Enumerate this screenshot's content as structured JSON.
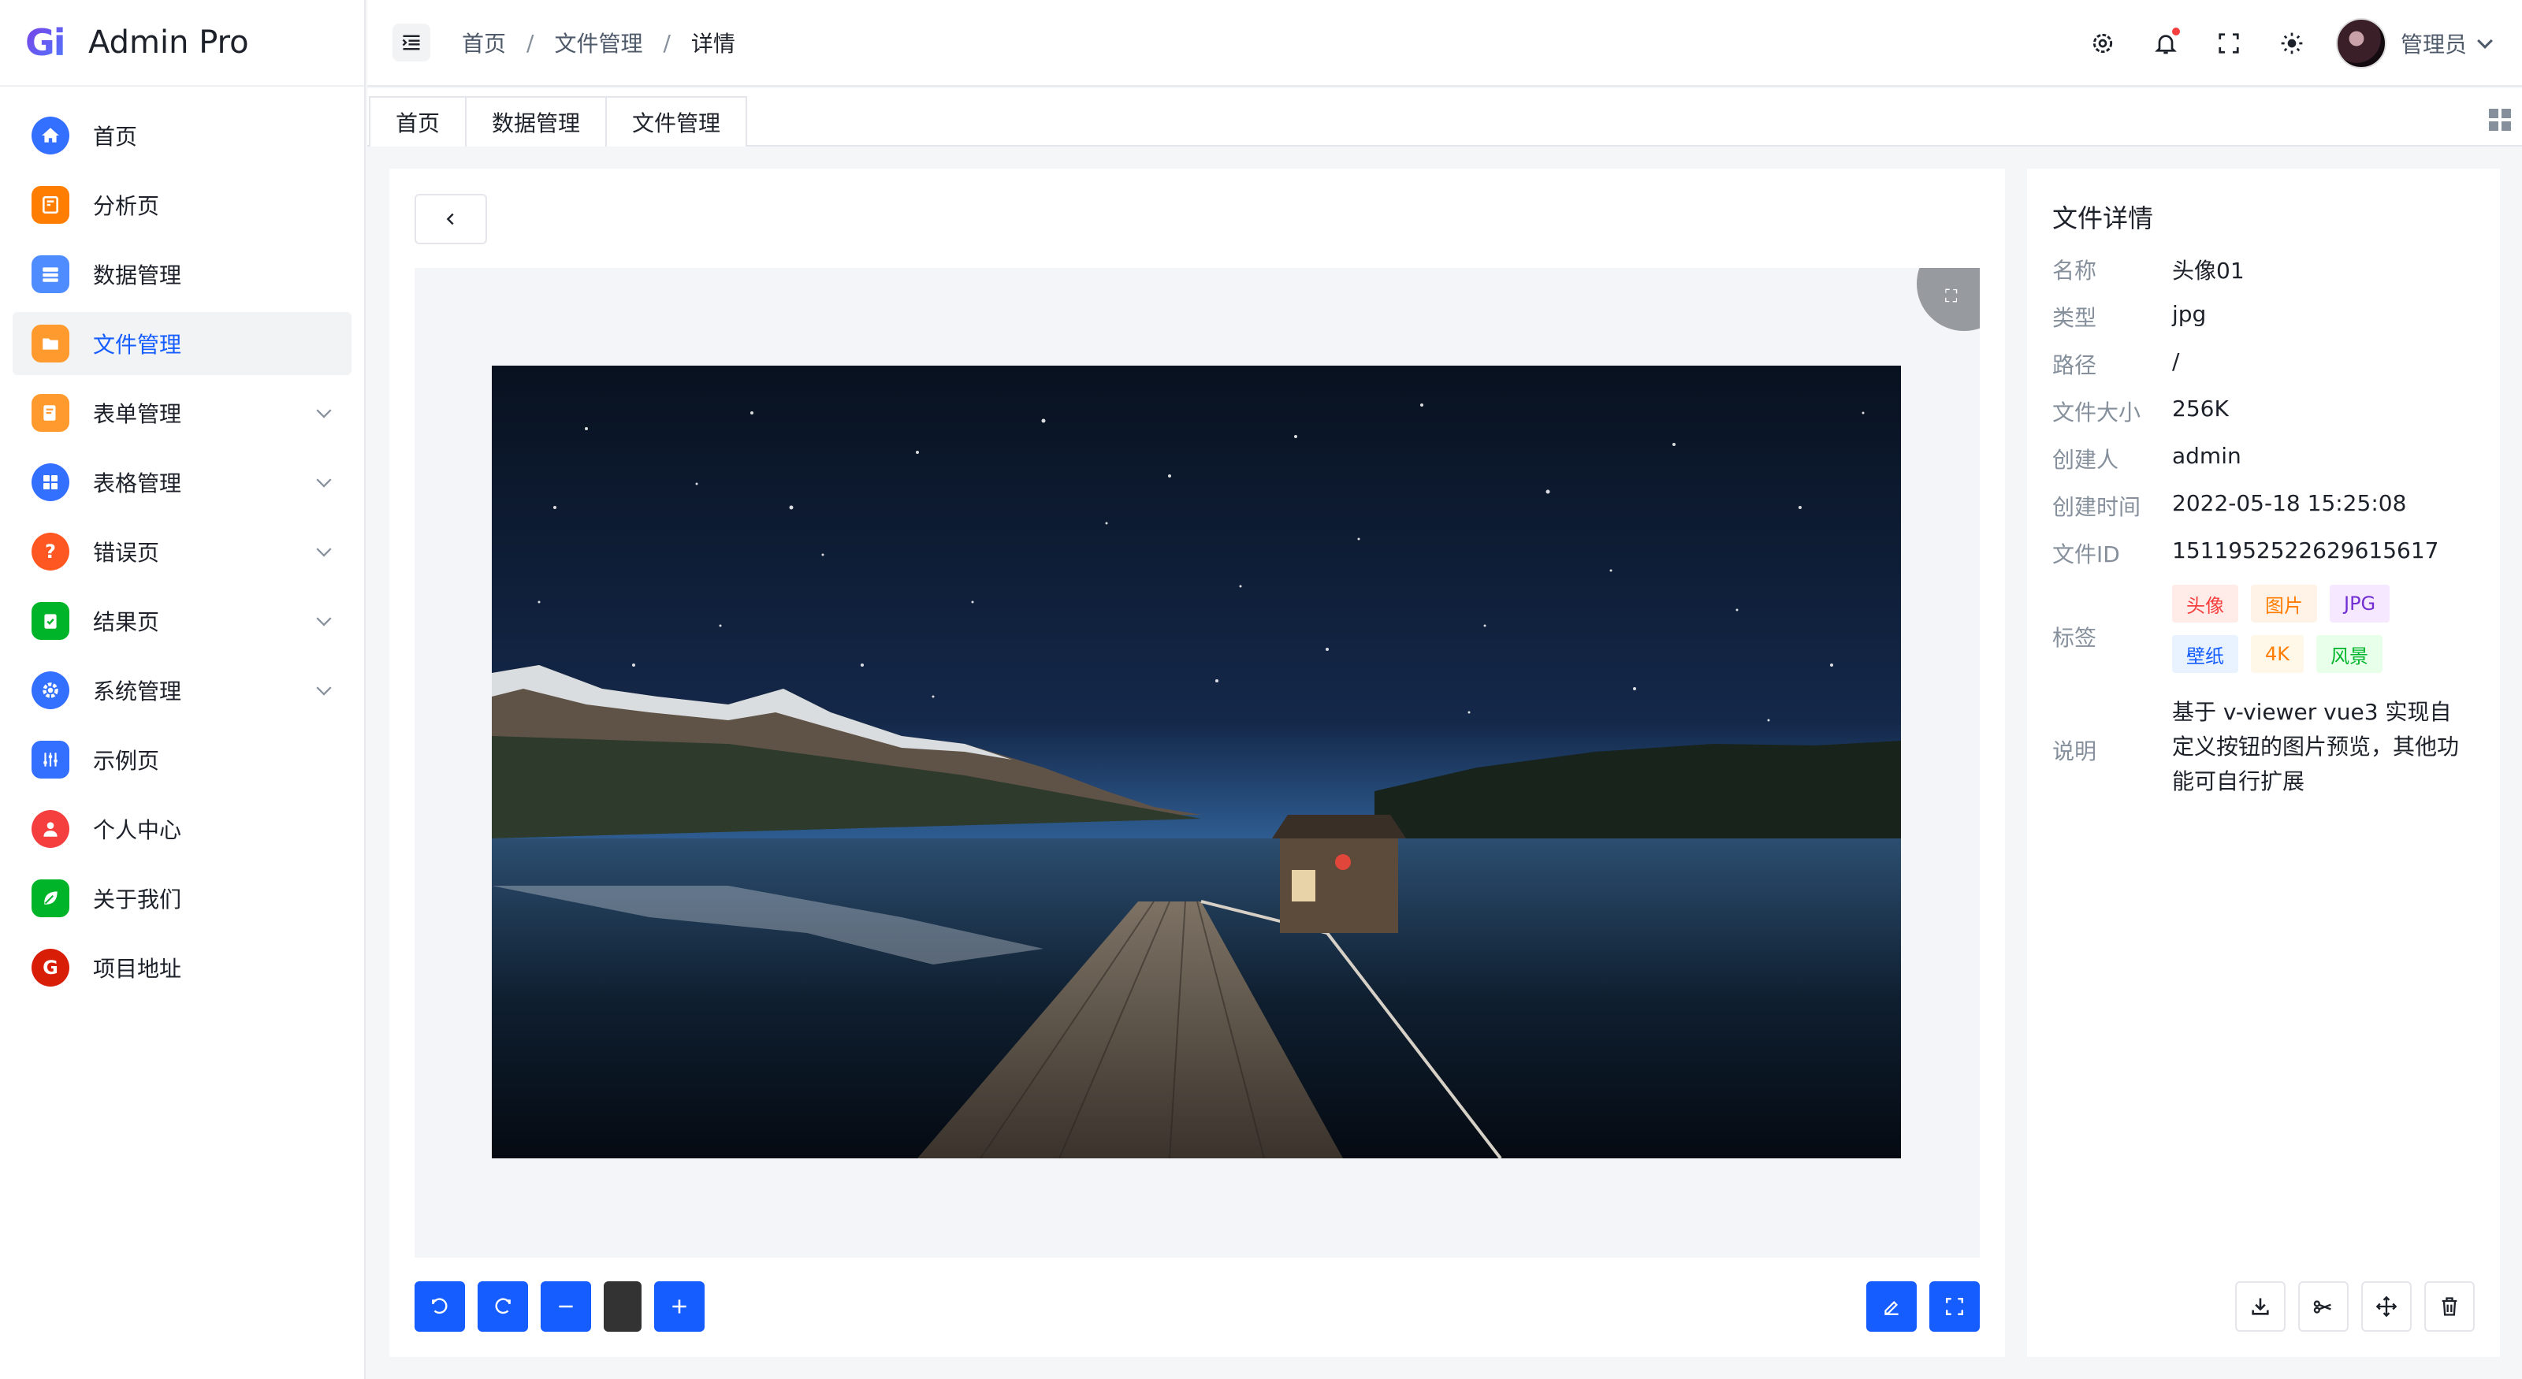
{
  "app": {
    "logo_mark": "Gi",
    "title": "Admin Pro"
  },
  "sidebar": {
    "items": [
      {
        "label": "首页",
        "color": "#3370ff",
        "icon": "home-icon"
      },
      {
        "label": "分析页",
        "color": "#ff7d00",
        "icon": "analysis-icon"
      },
      {
        "label": "数据管理",
        "color": "#4e8cff",
        "icon": "database-icon"
      },
      {
        "label": "文件管理",
        "color": "#ff9a2e",
        "icon": "folder-icon"
      },
      {
        "label": "表单管理",
        "color": "#ff9a2e",
        "icon": "form-icon"
      },
      {
        "label": "表格管理",
        "color": "#3370ff",
        "icon": "table-icon"
      },
      {
        "label": "错误页",
        "color": "#ff5722",
        "icon": "question-icon"
      },
      {
        "label": "结果页",
        "color": "#00b42a",
        "icon": "clipboard-check-icon"
      },
      {
        "label": "系统管理",
        "color": "#3370ff",
        "icon": "gear-icon"
      },
      {
        "label": "示例页",
        "color": "#3370ff",
        "icon": "sliders-icon"
      },
      {
        "label": "个人中心",
        "color": "#f53f3f",
        "icon": "user-icon"
      },
      {
        "label": "关于我们",
        "color": "#00b42a",
        "icon": "leaf-icon"
      },
      {
        "label": "项目地址",
        "color": "#f53f3f",
        "icon": "gitee-icon"
      }
    ]
  },
  "header": {
    "breadcrumb": [
      "首页",
      "文件管理",
      "详情"
    ],
    "user_name": "管理员",
    "icons": [
      "settings-icon",
      "bell-icon",
      "fullscreen-icon",
      "theme-icon"
    ]
  },
  "tabs": [
    "首页",
    "数据管理",
    "文件管理"
  ],
  "detail": {
    "title": "文件详情",
    "fields": [
      {
        "label": "名称",
        "value": "头像01"
      },
      {
        "label": "类型",
        "value": "jpg"
      },
      {
        "label": "路径",
        "value": "/"
      },
      {
        "label": "文件大小",
        "value": "256K"
      },
      {
        "label": "创建人",
        "value": "admin"
      },
      {
        "label": "创建时间",
        "value": "2022-05-18 15:25:08"
      },
      {
        "label": "文件ID",
        "value": "1511952522629615617"
      }
    ],
    "tags_label": "标签",
    "tags": [
      {
        "text": "头像",
        "fg": "#f53f3f",
        "bg": "#ffece8"
      },
      {
        "text": "图片",
        "fg": "#ff7d00",
        "bg": "#fff3e8"
      },
      {
        "text": "JPG",
        "fg": "#722ed1",
        "bg": "#f5e8ff"
      },
      {
        "text": "壁纸",
        "fg": "#165dff",
        "bg": "#e8f3ff"
      },
      {
        "text": "4K",
        "fg": "#ff7d00",
        "bg": "#fff7e8"
      },
      {
        "text": "风景",
        "fg": "#00b42a",
        "bg": "#e8ffea"
      }
    ],
    "desc_label": "说明",
    "description": "基于 v-viewer vue3 实现自定义按钮的图片预览，其他功能可自行扩展"
  },
  "colors": {
    "primary": "#165dff"
  }
}
